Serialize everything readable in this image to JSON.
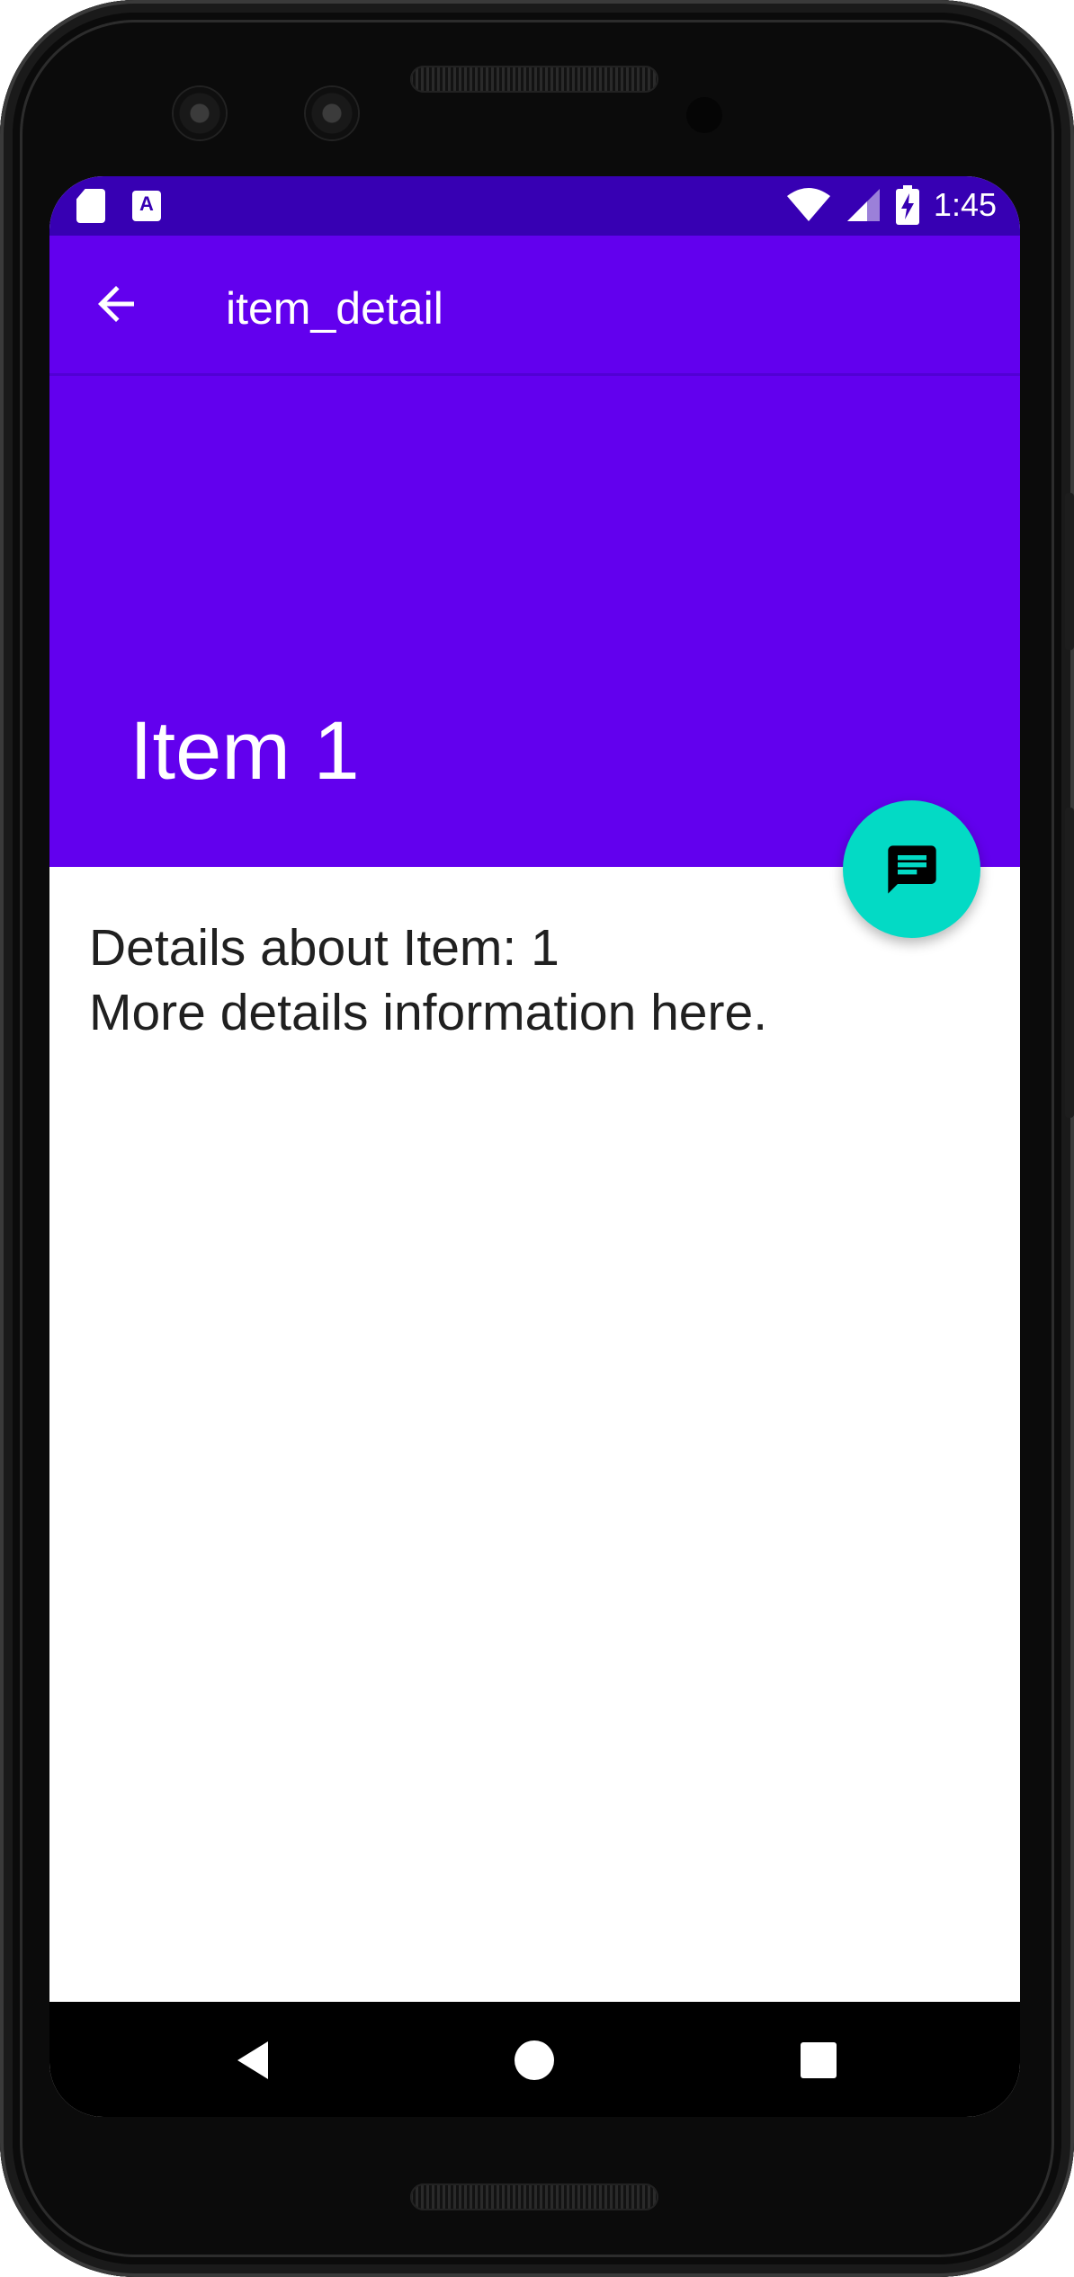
{
  "status_bar": {
    "time": "1:45",
    "icons": [
      "sd-card-icon",
      "a-keyboard-icon",
      "wifi-icon",
      "cellular-signal-icon",
      "battery-charging-icon"
    ],
    "a_icon_letter": "A",
    "background_color": "#3700B3"
  },
  "app_bar": {
    "title": "item_detail",
    "back_icon": "arrow-back-icon",
    "background_color": "#6200EE"
  },
  "header": {
    "item_title": "Item 1"
  },
  "fab": {
    "icon": "message-icon",
    "color": "#03DAC5"
  },
  "content": {
    "line1": "Details about Item: 1",
    "line2": "More details information here."
  },
  "nav_bar": {
    "icons": [
      "nav-back-icon",
      "nav-home-icon",
      "nav-recents-icon"
    ]
  }
}
